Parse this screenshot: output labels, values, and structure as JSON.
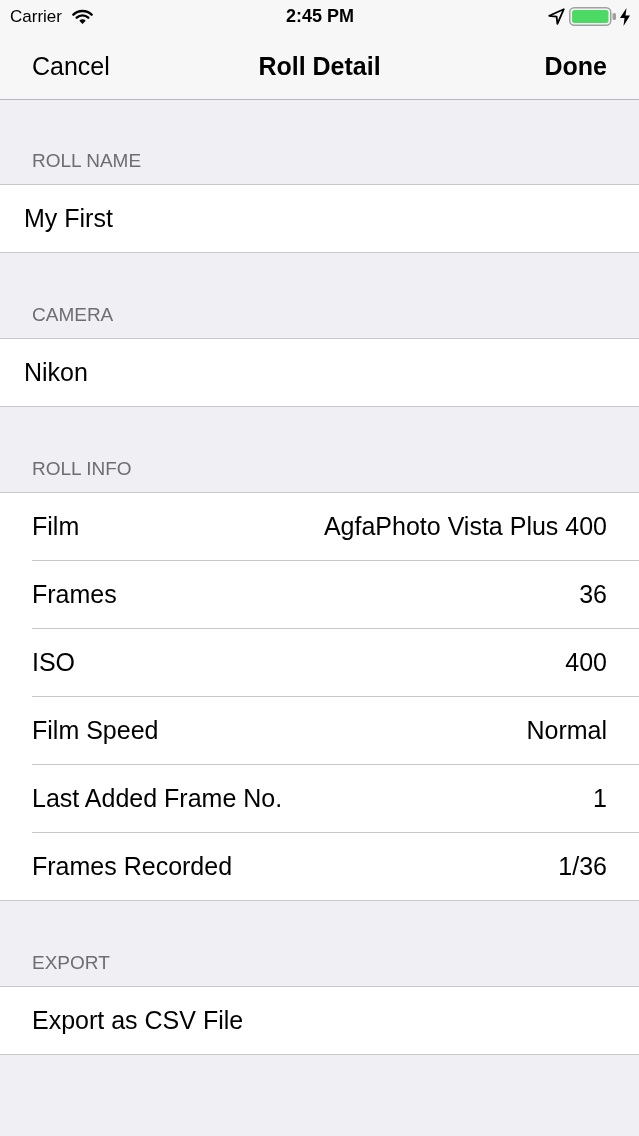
{
  "status_bar": {
    "carrier": "Carrier",
    "time": "2:45 PM",
    "charging": true
  },
  "nav_bar": {
    "left_button": "Cancel",
    "title": "Roll Detail",
    "right_button": "Done"
  },
  "sections": [
    {
      "header": "ROLL NAME",
      "rows": [
        {
          "kind": "text_field",
          "value": "My First"
        }
      ]
    },
    {
      "header": "CAMERA",
      "rows": [
        {
          "kind": "text_field",
          "value": "Nikon"
        }
      ]
    },
    {
      "header": "ROLL INFO",
      "rows": [
        {
          "kind": "detail",
          "label": "Film",
          "value": "AgfaPhoto Vista Plus 400"
        },
        {
          "kind": "detail",
          "label": "Frames",
          "value": "36"
        },
        {
          "kind": "detail",
          "label": "ISO",
          "value": "400"
        },
        {
          "kind": "detail",
          "label": "Film Speed",
          "value": "Normal"
        },
        {
          "kind": "detail",
          "label": "Last Added Frame No.",
          "value": "1"
        },
        {
          "kind": "detail",
          "label": "Frames Recorded",
          "value": "1/36"
        }
      ]
    },
    {
      "header": "EXPORT",
      "rows": [
        {
          "kind": "action",
          "label": "Export as CSV File"
        }
      ]
    }
  ]
}
